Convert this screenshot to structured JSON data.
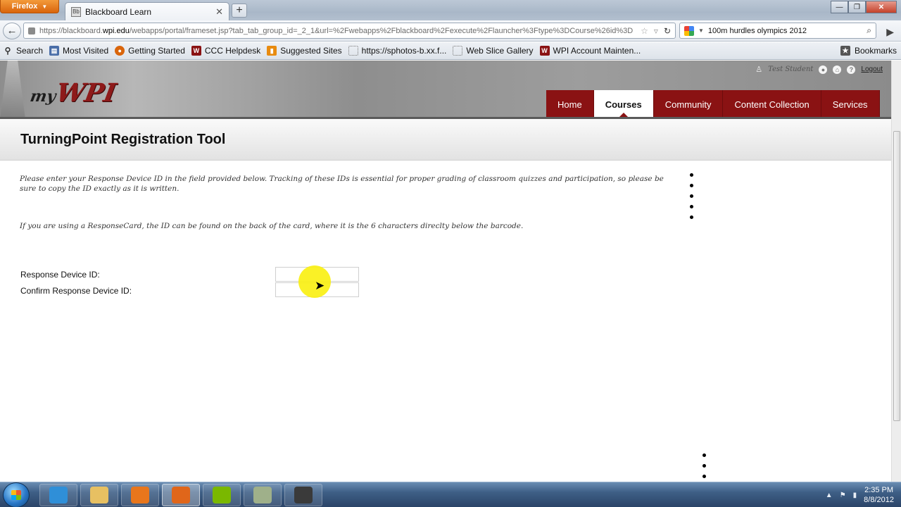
{
  "browser": {
    "app_button": "Firefox",
    "tab_title": "Blackboard Learn",
    "url_prefix": "https://blackboard.",
    "url_domain": "wpi.edu",
    "url_rest": "/webapps/portal/frameset.jsp?tab_tab_group_id=_2_1&url=%2Fwebapps%2Fblackboard%2Fexecute%2Flauncher%3Ftype%3DCourse%26id%3D",
    "search_value": "100m hurdles olympics 2012"
  },
  "bookmarks": {
    "items": [
      {
        "label": "Search",
        "icon": "search-icon",
        "color": "#333333"
      },
      {
        "label": "Most Visited",
        "icon": "most-visited-icon",
        "color": "#4a6ea8"
      },
      {
        "label": "Getting Started",
        "icon": "firefox-icon",
        "color": "#d9650c"
      },
      {
        "label": "CCC Helpdesk",
        "icon": "wpi-icon",
        "color": "#8a1213"
      },
      {
        "label": "Suggested Sites",
        "icon": "suggested-sites-icon",
        "color": "#e88b10"
      },
      {
        "label": "https://sphotos-b.xx.f...",
        "icon": "page-icon",
        "color": "#ffffff"
      },
      {
        "label": "Web Slice Gallery",
        "icon": "page-icon",
        "color": "#ffffff"
      },
      {
        "label": "WPI Account Mainten...",
        "icon": "wpi-icon",
        "color": "#8a1213"
      }
    ],
    "right_label": "Bookmarks"
  },
  "header": {
    "logo_my": "my",
    "logo_wpi": "WPI",
    "user_name": "Test Student",
    "logout": "Logout",
    "tabs": [
      {
        "label": "Home",
        "active": false
      },
      {
        "label": "Courses",
        "active": true
      },
      {
        "label": "Community",
        "active": false
      },
      {
        "label": "Content Collection",
        "active": false
      },
      {
        "label": "Services",
        "active": false
      }
    ]
  },
  "content": {
    "title": "TurningPoint Registration Tool",
    "instructions": "Please enter your Response Device ID in the field provided below. Tracking of these IDs is essential for proper grading of classroom quizzes and participation, so please be sure to copy the ID exactly as it is written.",
    "hint": "If you are using a ResponseCard, the ID can be found on the back of the card, where it is the 6 characters direclty below the barcode.",
    "form": {
      "device_id_label": "Response Device ID:",
      "device_id_value": "",
      "confirm_label": "Confirm Response Device ID:",
      "confirm_value": ""
    }
  },
  "taskbar": {
    "apps": [
      {
        "name": "internet-explorer-icon",
        "color": "#2f8fd8",
        "active": false
      },
      {
        "name": "file-explorer-icon",
        "color": "#e7c062",
        "active": false
      },
      {
        "name": "media-player-icon",
        "color": "#e8761c",
        "active": false
      },
      {
        "name": "firefox-icon",
        "color": "#e0661a",
        "active": true
      },
      {
        "name": "spotify-icon",
        "color": "#7ab800",
        "active": false
      },
      {
        "name": "notes-app-icon",
        "color": "#9fb08a",
        "active": false
      },
      {
        "name": "camera-app-icon",
        "color": "#3a3a3a",
        "active": false
      }
    ],
    "time": "2:35 PM",
    "date": "8/8/2012"
  }
}
